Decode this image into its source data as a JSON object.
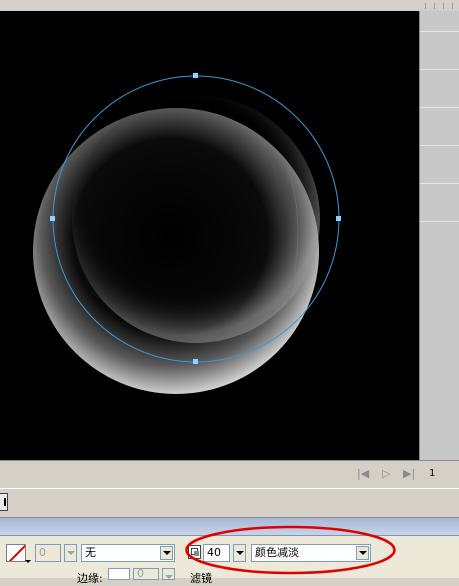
{
  "playback": {
    "first_icon": "rewind-icon",
    "play_icon": "play-icon",
    "last_icon": "step-end-icon",
    "frame_number": "1"
  },
  "properties": {
    "stroke_swatch_icon": "no-stroke-swatch",
    "stroke_width_value": "0",
    "stroke_style_value": "无",
    "alpha_icon": "alpha-icon",
    "alpha_value": "40",
    "blend_mode_value": "颜色减淡",
    "bottom_label_1": "边缘:",
    "bottom_field_value": "0",
    "bottom_label_2": "滤镜"
  },
  "colors": {
    "canvas": "#000000",
    "selection": "#3a9ad9",
    "highlight_ellipse": "#e00000",
    "panel": "#d4d0c8"
  }
}
